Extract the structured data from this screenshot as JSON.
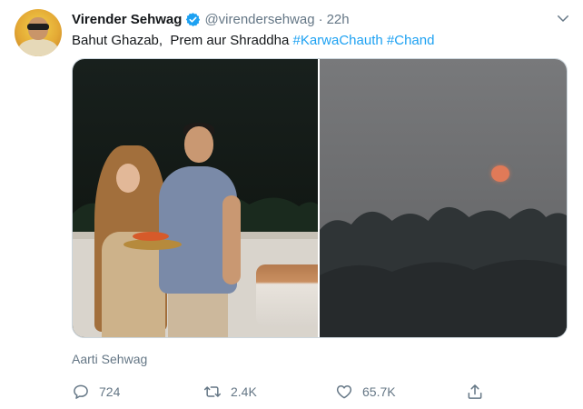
{
  "author": {
    "name": "Virender Sehwag",
    "handle": "@virendersehwag",
    "separator": "·",
    "time": "22h",
    "verified": true
  },
  "tweet": {
    "text_plain": "Bahut Ghazab,  Prem aur Shraddha ",
    "hashtags": [
      "#KarwaChauth",
      "#Chand"
    ]
  },
  "media": {
    "count": 2,
    "photo_credit": "Aarti Sehwag"
  },
  "actions": {
    "reply_count": "724",
    "retweet_count": "2.4K",
    "like_count": "65.7K"
  },
  "icons": {
    "verified": "verified-badge-icon",
    "caret": "chevron-down-icon",
    "reply": "reply-icon",
    "retweet": "retweet-icon",
    "like": "heart-icon",
    "share": "share-icon"
  },
  "colors": {
    "accent": "#1da1f2",
    "secondary_text": "#657786",
    "primary_text": "#14171a"
  }
}
